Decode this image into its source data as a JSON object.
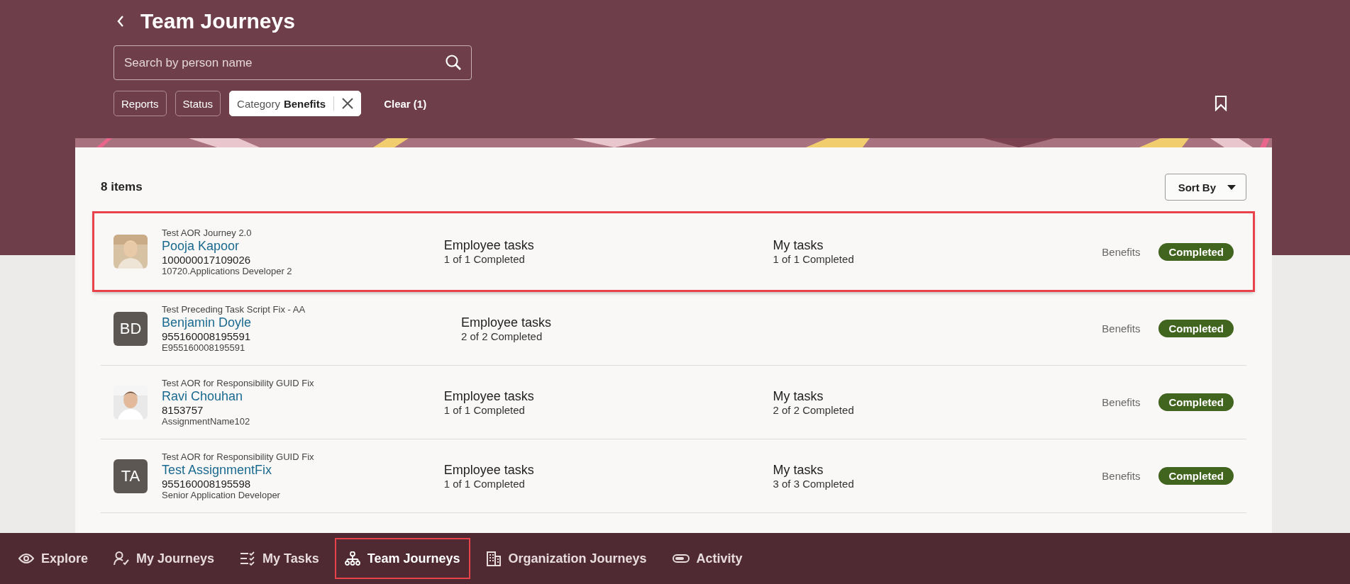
{
  "page": {
    "title": "Team Journeys"
  },
  "search": {
    "placeholder": "Search by person name"
  },
  "filters": [
    {
      "kind": "chip",
      "label": "Reports"
    },
    {
      "kind": "chip",
      "label": "Status"
    },
    {
      "kind": "applied",
      "label": "Category",
      "value": "Benefits"
    }
  ],
  "clear": {
    "label": "Clear (1)"
  },
  "list": {
    "count": "8 items",
    "sort": "Sort By",
    "rows": [
      {
        "journey": "Test AOR Journey 2.0",
        "name": "Pooja Kapoor",
        "number": "100000017109026",
        "assignment": "10720.Applications Developer 2",
        "avatar": {
          "kind": "picture"
        },
        "tasks": [
          {
            "title": "Employee tasks",
            "progress": "1 of 1 Completed"
          },
          {
            "title": "My tasks",
            "progress": "1 of 1 Completed"
          }
        ],
        "category": "Benefits",
        "status": "Completed",
        "highlighted": true
      },
      {
        "journey": "Test Preceding Task Script Fix - AA",
        "name": "Benjamin Doyle",
        "number": "955160008195591",
        "assignment": "E955160008195591",
        "avatar": {
          "kind": "initials",
          "text": "BD"
        },
        "tasks": [
          {
            "title": "Employee tasks",
            "progress": "2 of 2 Completed"
          }
        ],
        "category": "Benefits",
        "status": "Completed",
        "highlighted": false
      },
      {
        "journey": "Test AOR for Responsibility GUID Fix",
        "name": "Ravi Chouhan",
        "number": "8153757",
        "assignment": "AssignmentName102",
        "avatar": {
          "kind": "picture"
        },
        "tasks": [
          {
            "title": "Employee tasks",
            "progress": "1 of 1 Completed"
          },
          {
            "title": "My tasks",
            "progress": "2 of 2 Completed"
          }
        ],
        "category": "Benefits",
        "status": "Completed",
        "highlighted": false
      },
      {
        "journey": "Test AOR for Responsibility GUID Fix",
        "name": "Test AssignmentFix",
        "number": "955160008195598",
        "assignment": "Senior Application Developer",
        "avatar": {
          "kind": "initials",
          "text": "TA"
        },
        "tasks": [
          {
            "title": "Employee tasks",
            "progress": "1 of 1 Completed"
          },
          {
            "title": "My tasks",
            "progress": "3 of 3 Completed"
          }
        ],
        "category": "Benefits",
        "status": "Completed",
        "highlighted": false
      }
    ]
  },
  "nav": [
    {
      "kind": "explore",
      "label": "Explore",
      "selected": false
    },
    {
      "kind": "journeys",
      "label": "My Journeys",
      "selected": false
    },
    {
      "kind": "tasks",
      "label": "My Tasks",
      "selected": false
    },
    {
      "kind": "team",
      "label": "Team Journeys",
      "selected": true
    },
    {
      "kind": "organization",
      "label": "Organization Journeys",
      "selected": false
    },
    {
      "kind": "activity",
      "label": "Activity",
      "selected": false
    }
  ]
}
